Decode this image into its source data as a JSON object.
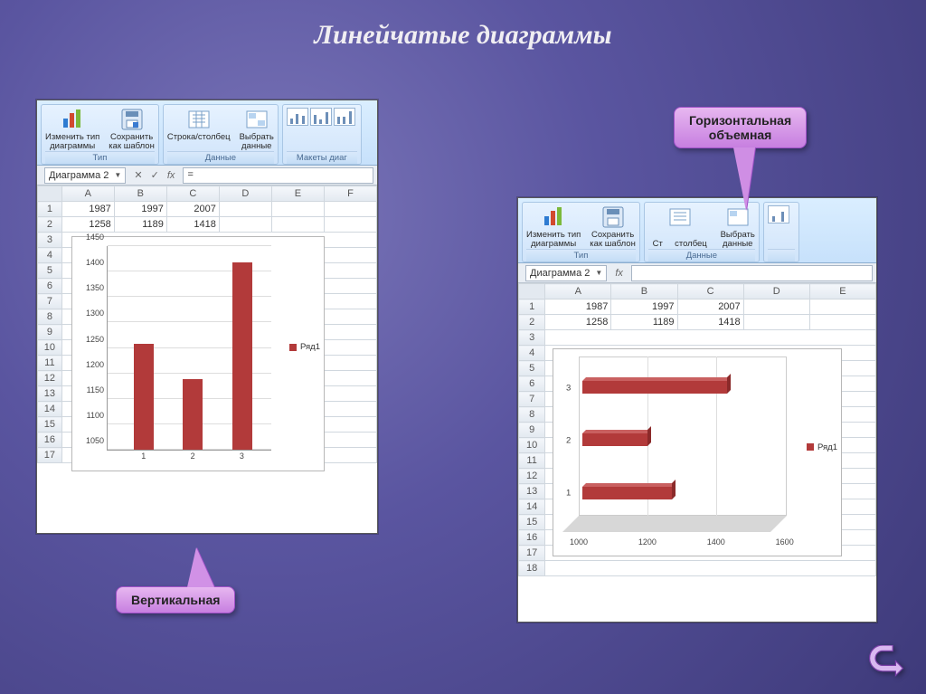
{
  "title": "Линейчатые  диаграммы",
  "callouts": {
    "vertical": "Вертикальная",
    "horizontal_3d_l1": "Горизонтальная",
    "horizontal_3d_l2": "объемная"
  },
  "ribbon": {
    "change_type_l1": "Изменить тип",
    "change_type_l2": "диаграммы",
    "save_template_l1": "Сохранить",
    "save_template_l2": "как шаблон",
    "group_type": "Тип",
    "row_col": "Строка/столбец",
    "select_data_l1": "Выбрать",
    "select_data_l2": "данные",
    "group_data": "Данные",
    "group_layouts": "Макеты диаг"
  },
  "namebox": "Диаграмма 2",
  "fxbar_left": "=",
  "column_headers": [
    "A",
    "B",
    "C",
    "D",
    "E",
    "F"
  ],
  "column_headers_right": [
    "A",
    "B",
    "C",
    "D",
    "E"
  ],
  "data_rows": {
    "r1": {
      "A": "1987",
      "B": "1997",
      "C": "2007"
    },
    "r2": {
      "A": "1258",
      "B": "1189",
      "C": "1418"
    }
  },
  "legend_label": "Ряд1",
  "chart_data": [
    {
      "id": "left_vertical_bar",
      "type": "bar",
      "categories": [
        "1",
        "2",
        "3"
      ],
      "values": [
        1258,
        1189,
        1418
      ],
      "series": [
        {
          "name": "Ряд1",
          "values": [
            1258,
            1189,
            1418
          ]
        }
      ],
      "ylim": [
        1050,
        1450
      ],
      "yticks": [
        1050,
        1100,
        1150,
        1200,
        1250,
        1300,
        1350,
        1400,
        1450
      ],
      "title": "",
      "xlabel": "",
      "ylabel": "",
      "legend_position": "right"
    },
    {
      "id": "right_horizontal_3d_bar",
      "type": "bar",
      "orientation": "horizontal",
      "three_d": true,
      "categories": [
        "1",
        "2",
        "3"
      ],
      "values": [
        1258,
        1189,
        1418
      ],
      "series": [
        {
          "name": "Ряд1",
          "values": [
            1258,
            1189,
            1418
          ]
        }
      ],
      "xlim": [
        1000,
        1600
      ],
      "xticks": [
        1000,
        1200,
        1400,
        1600
      ],
      "title": "",
      "xlabel": "",
      "ylabel": "",
      "legend_position": "right"
    }
  ]
}
